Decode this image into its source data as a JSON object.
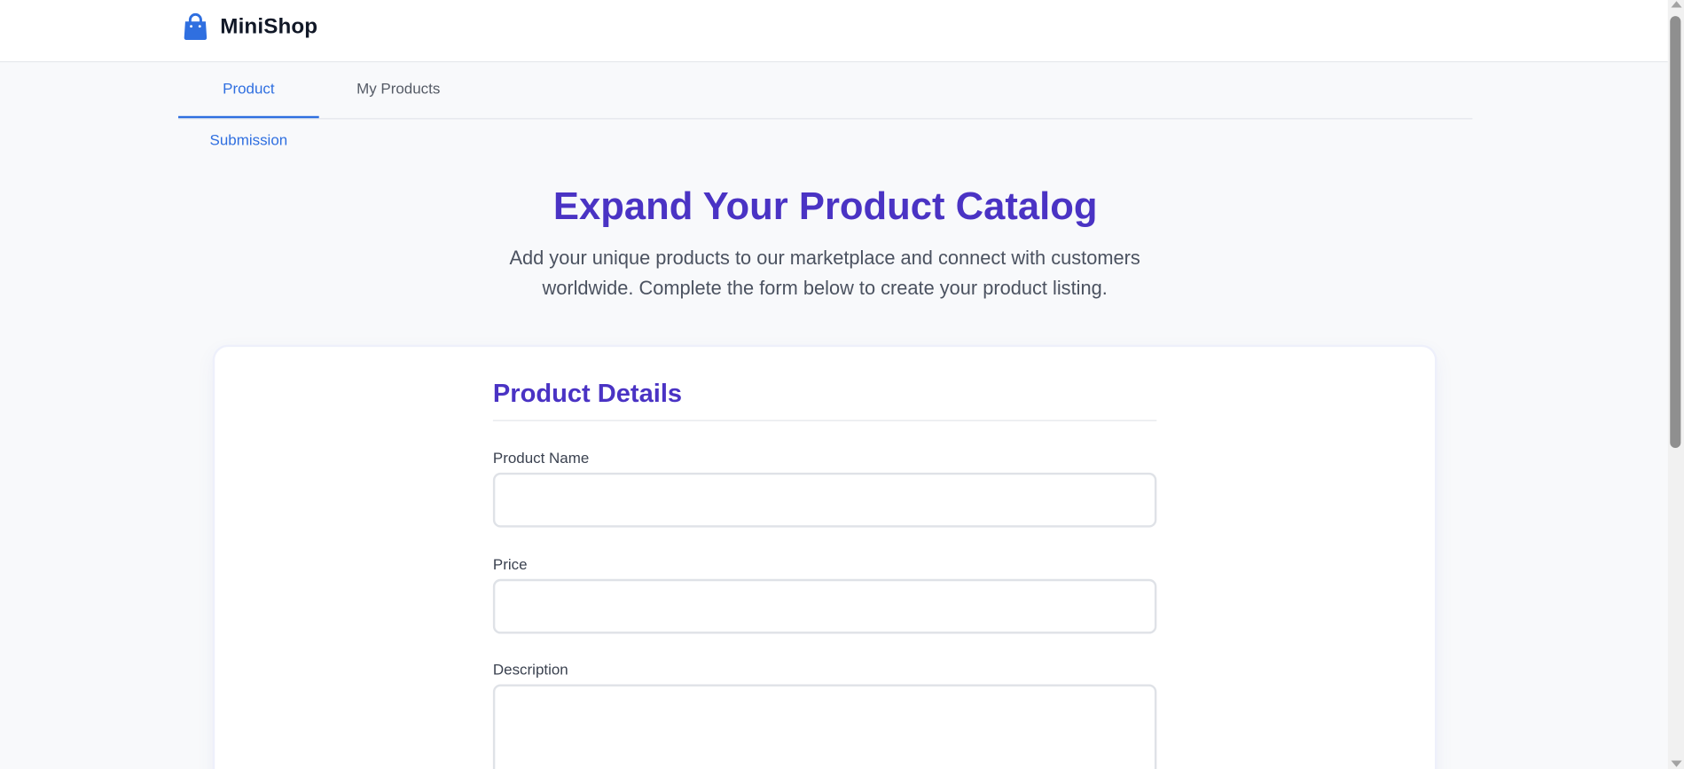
{
  "header": {
    "brand_name": "MiniShop",
    "brand_icon": "shopping-bag-icon",
    "brand_color": "#2f6fe0"
  },
  "tabs": [
    {
      "label": "Product Submission",
      "active": true
    },
    {
      "label": "My Products",
      "active": false
    }
  ],
  "hero": {
    "title": "Expand Your Product Catalog",
    "subtitle": "Add your unique products to our marketplace and connect with customers worldwide. Complete the form below to create your product listing."
  },
  "form": {
    "section_title": "Product Details",
    "fields": {
      "product_name": {
        "label": "Product Name",
        "value": "",
        "placeholder": ""
      },
      "price": {
        "label": "Price",
        "value": "",
        "placeholder": ""
      },
      "description": {
        "label": "Description",
        "value": "",
        "placeholder": ""
      }
    }
  },
  "colors": {
    "accent": "#2f6fe0",
    "heading": "#4a33c4",
    "background": "#f8f9fb"
  }
}
